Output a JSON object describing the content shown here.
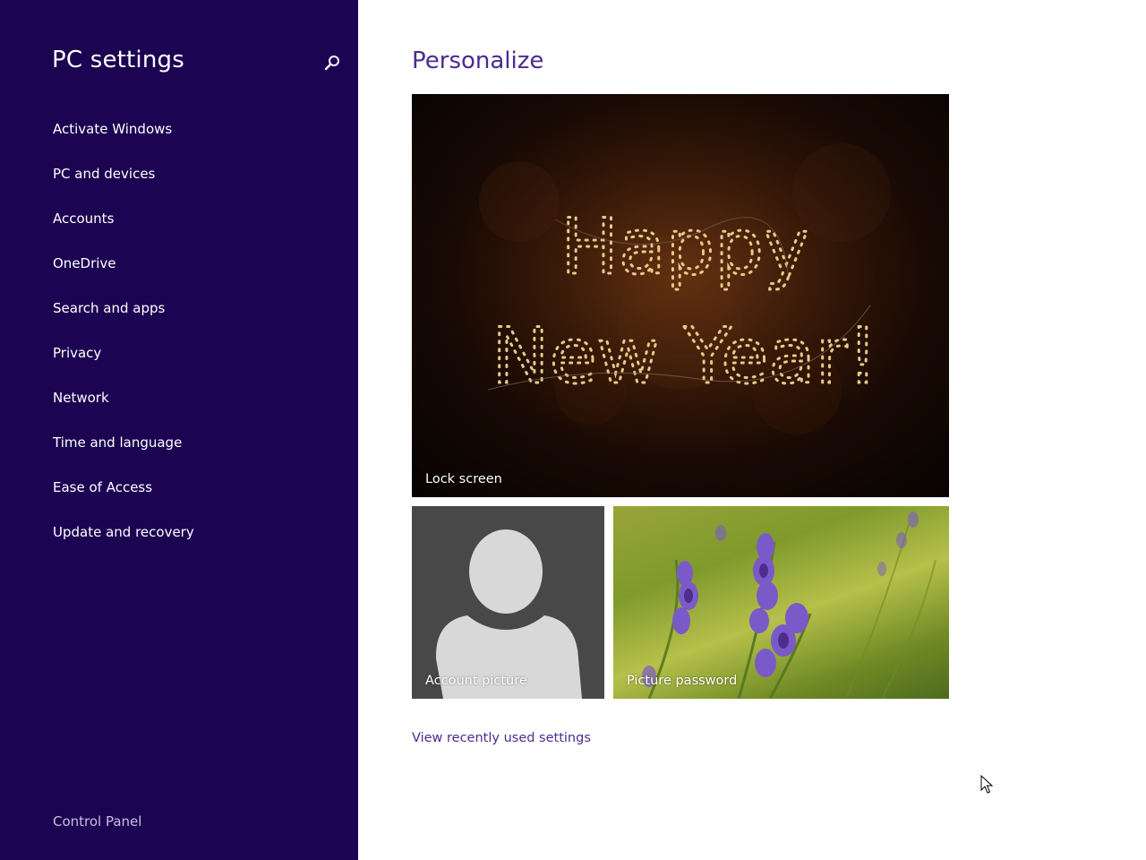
{
  "sidebar": {
    "title": "PC settings",
    "search_icon": "search-icon",
    "items": [
      {
        "label": "Activate Windows"
      },
      {
        "label": "PC and devices"
      },
      {
        "label": "Accounts"
      },
      {
        "label": "OneDrive"
      },
      {
        "label": "Search and apps"
      },
      {
        "label": "Privacy"
      },
      {
        "label": "Network"
      },
      {
        "label": "Time and language"
      },
      {
        "label": "Ease of Access"
      },
      {
        "label": "Update and recovery"
      }
    ],
    "footer_link": "Control Panel"
  },
  "main": {
    "title": "Personalize",
    "tiles": {
      "lock_screen": {
        "label": "Lock screen",
        "image_text_line1": "Happy",
        "image_text_line2": "New Year!"
      },
      "account_picture": {
        "label": "Account picture"
      },
      "picture_password": {
        "label": "Picture password"
      }
    },
    "recent_link": "View recently used settings"
  },
  "colors": {
    "sidebar_bg": "#1c0452",
    "accent": "#4b2a93",
    "sidebar_text": "#ffffff"
  }
}
